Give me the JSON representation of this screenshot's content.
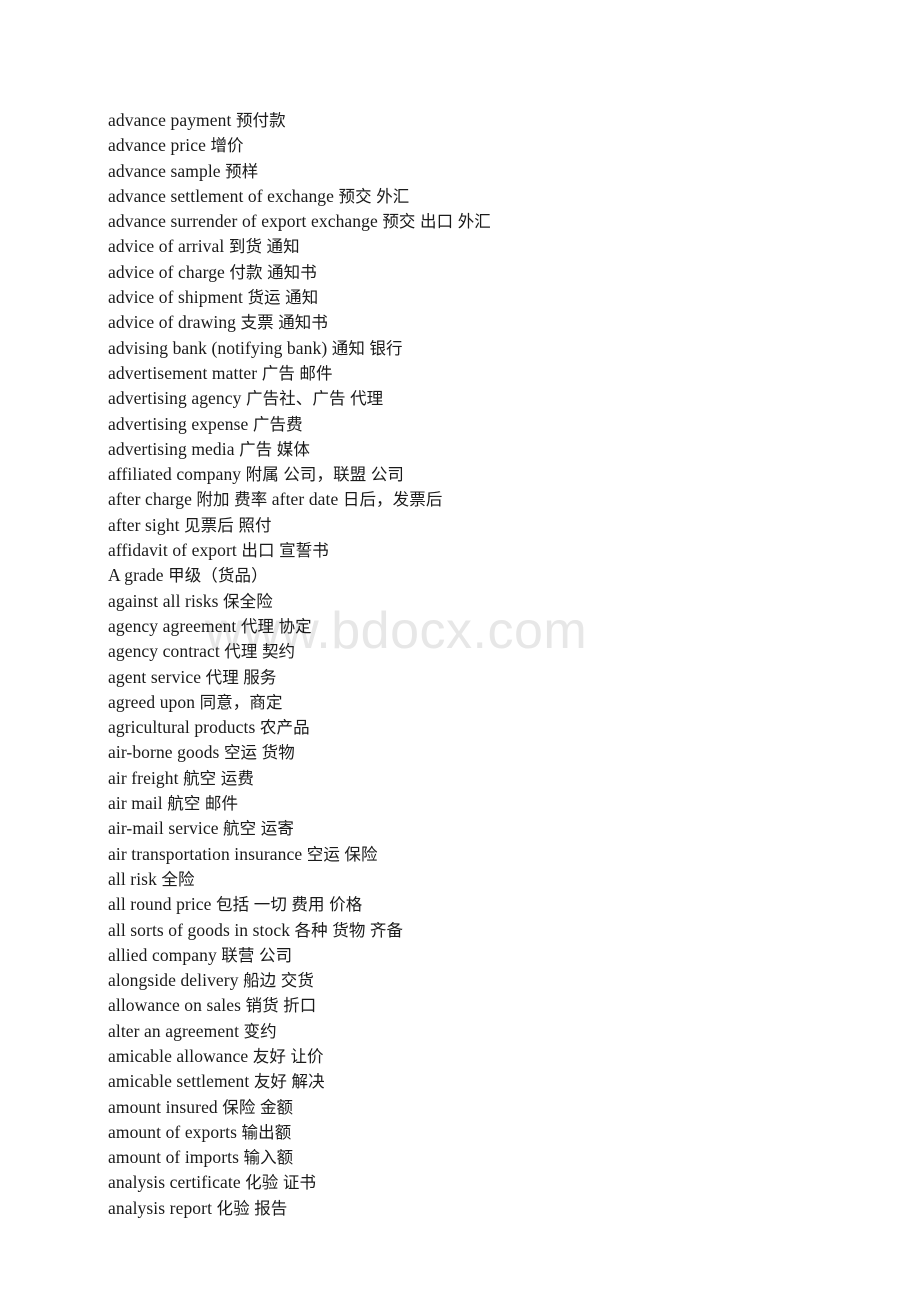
{
  "document": {
    "type": "glossary-page",
    "language_pair": "English-Chinese",
    "background_color": "#ffffff",
    "text_color": "#1a1a1a"
  },
  "watermark": {
    "text": "www.bdocx.com",
    "color": "#e7e7e7"
  },
  "glossary": {
    "entries": [
      "advance payment 预付款",
      "advance price 增价",
      "advance sample 预样",
      "advance settlement of exchange 预交 外汇",
      "advance surrender of export exchange 预交 出口 外汇",
      "advice of arrival 到货 通知",
      "advice of charge 付款 通知书",
      "advice of shipment 货运 通知",
      "advice of drawing 支票 通知书",
      "advising bank (notifying bank) 通知 银行",
      "advertisement matter 广告 邮件",
      "advertising agency 广告社、广告 代理",
      "advertising expense 广告费",
      "advertising media 广告 媒体",
      "affiliated company 附属 公司，联盟 公司",
      "after charge 附加 费率 after date 日后，发票后",
      "after sight 见票后 照付",
      "affidavit of export 出口 宣誓书",
      "A grade 甲级（货品）",
      "against all risks 保全险",
      "agency agreement 代理 协定",
      "agency contract 代理 契约",
      "agent service 代理 服务",
      "agreed upon 同意，商定",
      "agricultural products 农产品",
      "air-borne goods 空运 货物",
      "air freight 航空 运费",
      "air mail 航空 邮件",
      "air-mail service 航空 运寄",
      "air transportation insurance 空运 保险",
      "all risk 全险",
      "all round price 包括 一切 费用 价格",
      "all sorts of goods in stock 各种 货物 齐备",
      "allied company 联营 公司",
      "alongside delivery 船边 交货",
      "allowance on sales 销货 折口",
      "alter an agreement 变约",
      "amicable allowance 友好 让价",
      "amicable settlement 友好 解决",
      "amount insured 保险 金额",
      "amount of exports 输出额",
      "amount of imports 输入额",
      "analysis certificate 化验 证书",
      "analysis report 化验 报告"
    ]
  }
}
